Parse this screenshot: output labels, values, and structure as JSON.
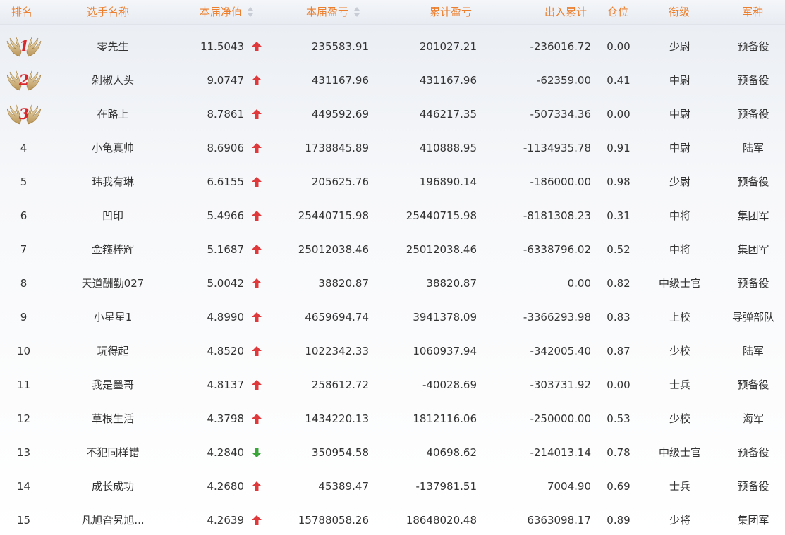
{
  "headers": {
    "rank": "排名",
    "name": "选手名称",
    "nav": "本届净值",
    "curr_pnl": "本届盈亏",
    "cum_pnl": "累计盈亏",
    "flow": "出入累计",
    "position": "仓位",
    "level": "衔级",
    "arm": "军种"
  },
  "colors": {
    "header_text": "#ec7f2e",
    "up_arrow": "#e0393b",
    "down_arrow": "#3aa63a",
    "medal_number": "#d8272b"
  },
  "rows": [
    {
      "rank": "1",
      "medal": true,
      "name": "零先生",
      "nav": "11.5043",
      "trend": "up",
      "curr_pnl": "235583.91",
      "cum_pnl": "201027.21",
      "flow": "-236016.72",
      "position": "0.00",
      "level": "少尉",
      "arm": "预备役"
    },
    {
      "rank": "2",
      "medal": true,
      "name": "剁椒人头",
      "nav": "9.0747",
      "trend": "up",
      "curr_pnl": "431167.96",
      "cum_pnl": "431167.96",
      "flow": "-62359.00",
      "position": "0.41",
      "level": "中尉",
      "arm": "预备役"
    },
    {
      "rank": "3",
      "medal": true,
      "name": "在路上",
      "nav": "8.7861",
      "trend": "up",
      "curr_pnl": "449592.69",
      "cum_pnl": "446217.35",
      "flow": "-507334.36",
      "position": "0.00",
      "level": "中尉",
      "arm": "预备役"
    },
    {
      "rank": "4",
      "medal": false,
      "name": "小龟真帅",
      "nav": "8.6906",
      "trend": "up",
      "curr_pnl": "1738845.89",
      "cum_pnl": "410888.95",
      "flow": "-1134935.78",
      "position": "0.91",
      "level": "中尉",
      "arm": "陆军"
    },
    {
      "rank": "5",
      "medal": false,
      "name": "玮我有琳",
      "nav": "6.6155",
      "trend": "up",
      "curr_pnl": "205625.76",
      "cum_pnl": "196890.14",
      "flow": "-186000.00",
      "position": "0.98",
      "level": "少尉",
      "arm": "预备役"
    },
    {
      "rank": "6",
      "medal": false,
      "name": "凹印",
      "nav": "5.4966",
      "trend": "up",
      "curr_pnl": "25440715.98",
      "cum_pnl": "25440715.98",
      "flow": "-8181308.23",
      "position": "0.31",
      "level": "中将",
      "arm": "集团军"
    },
    {
      "rank": "7",
      "medal": false,
      "name": "金箍棒辉",
      "nav": "5.1687",
      "trend": "up",
      "curr_pnl": "25012038.46",
      "cum_pnl": "25012038.46",
      "flow": "-6338796.02",
      "position": "0.52",
      "level": "中将",
      "arm": "集团军"
    },
    {
      "rank": "8",
      "medal": false,
      "name": "天道酬勤027",
      "nav": "5.0042",
      "trend": "up",
      "curr_pnl": "38820.87",
      "cum_pnl": "38820.87",
      "flow": "0.00",
      "position": "0.82",
      "level": "中级士官",
      "arm": "预备役"
    },
    {
      "rank": "9",
      "medal": false,
      "name": "小星星1",
      "nav": "4.8990",
      "trend": "up",
      "curr_pnl": "4659694.74",
      "cum_pnl": "3941378.09",
      "flow": "-3366293.98",
      "position": "0.83",
      "level": "上校",
      "arm": "导弹部队"
    },
    {
      "rank": "10",
      "medal": false,
      "name": "玩得起",
      "nav": "4.8520",
      "trend": "up",
      "curr_pnl": "1022342.33",
      "cum_pnl": "1060937.94",
      "flow": "-342005.40",
      "position": "0.87",
      "level": "少校",
      "arm": "陆军"
    },
    {
      "rank": "11",
      "medal": false,
      "name": "我是墨哥",
      "nav": "4.8137",
      "trend": "up",
      "curr_pnl": "258612.72",
      "cum_pnl": "-40028.69",
      "flow": "-303731.92",
      "position": "0.00",
      "level": "士兵",
      "arm": "预备役"
    },
    {
      "rank": "12",
      "medal": false,
      "name": "草根生活",
      "nav": "4.3798",
      "trend": "up",
      "curr_pnl": "1434220.13",
      "cum_pnl": "1812116.06",
      "flow": "-250000.00",
      "position": "0.53",
      "level": "少校",
      "arm": "海军"
    },
    {
      "rank": "13",
      "medal": false,
      "name": "不犯同样错",
      "nav": "4.2840",
      "trend": "down",
      "curr_pnl": "350954.58",
      "cum_pnl": "40698.62",
      "flow": "-214013.14",
      "position": "0.78",
      "level": "中级士官",
      "arm": "预备役"
    },
    {
      "rank": "14",
      "medal": false,
      "name": "成长成功",
      "nav": "4.2680",
      "trend": "up",
      "curr_pnl": "45389.47",
      "cum_pnl": "-137981.51",
      "flow": "7004.90",
      "position": "0.69",
      "level": "士兵",
      "arm": "预备役"
    },
    {
      "rank": "15",
      "medal": false,
      "name": "凡旭旮旯旭...",
      "nav": "4.2639",
      "trend": "up",
      "curr_pnl": "15788058.26",
      "cum_pnl": "18648020.48",
      "flow": "6363098.17",
      "position": "0.89",
      "level": "少将",
      "arm": "集团军"
    }
  ]
}
